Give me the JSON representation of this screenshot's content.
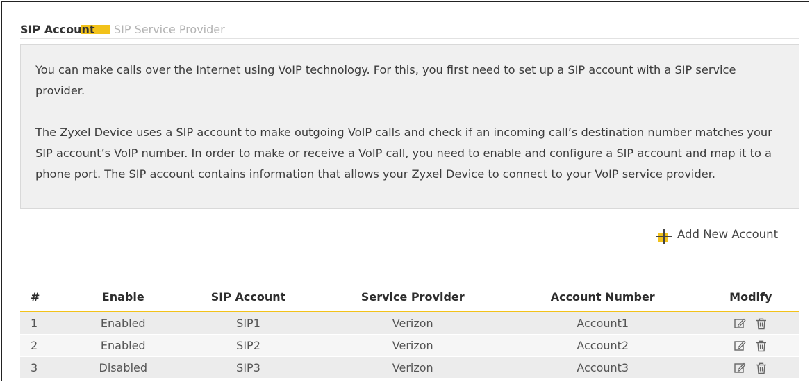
{
  "tabs": [
    {
      "label": "SIP Account",
      "active": true
    },
    {
      "label": "SIP Service Provider",
      "active": false
    }
  ],
  "note": {
    "paragraph1": "You can make calls over the Internet using VoIP technology. For this, you first need to set up a SIP account with a SIP service provider.",
    "paragraph2": "The Zyxel Device uses a SIP account to make outgoing VoIP calls and check if an incoming call’s destination number matches your SIP account’s VoIP number. In order to make or receive a VoIP call, you need to enable and configure a SIP account and map it to a phone port. The SIP account contains information that allows your Zyxel Device to connect to your VoIP service provider."
  },
  "actions": {
    "add_new_account": "Add New Account",
    "add_icon": "plus-icon"
  },
  "table": {
    "headers": {
      "num": "#",
      "enable": "Enable",
      "sip_account": "SIP Account",
      "service_provider": "Service Provider",
      "account_number": "Account Number",
      "modify": "Modify"
    },
    "rows": [
      {
        "num": "1",
        "enable": "Enabled",
        "sip_account": "SIP1",
        "service_provider": "Verizon",
        "account_number": "Account1"
      },
      {
        "num": "2",
        "enable": "Enabled",
        "sip_account": "SIP2",
        "service_provider": "Verizon",
        "account_number": "Account2"
      },
      {
        "num": "3",
        "enable": "Disabled",
        "sip_account": "SIP3",
        "service_provider": "Verizon",
        "account_number": "Account3"
      }
    ],
    "row_actions": [
      "edit-icon",
      "delete-icon"
    ]
  },
  "colors": {
    "accent": "#f2c21a",
    "inactive_tab": "#b3b3b3",
    "note_background": "#f0f0f0"
  }
}
